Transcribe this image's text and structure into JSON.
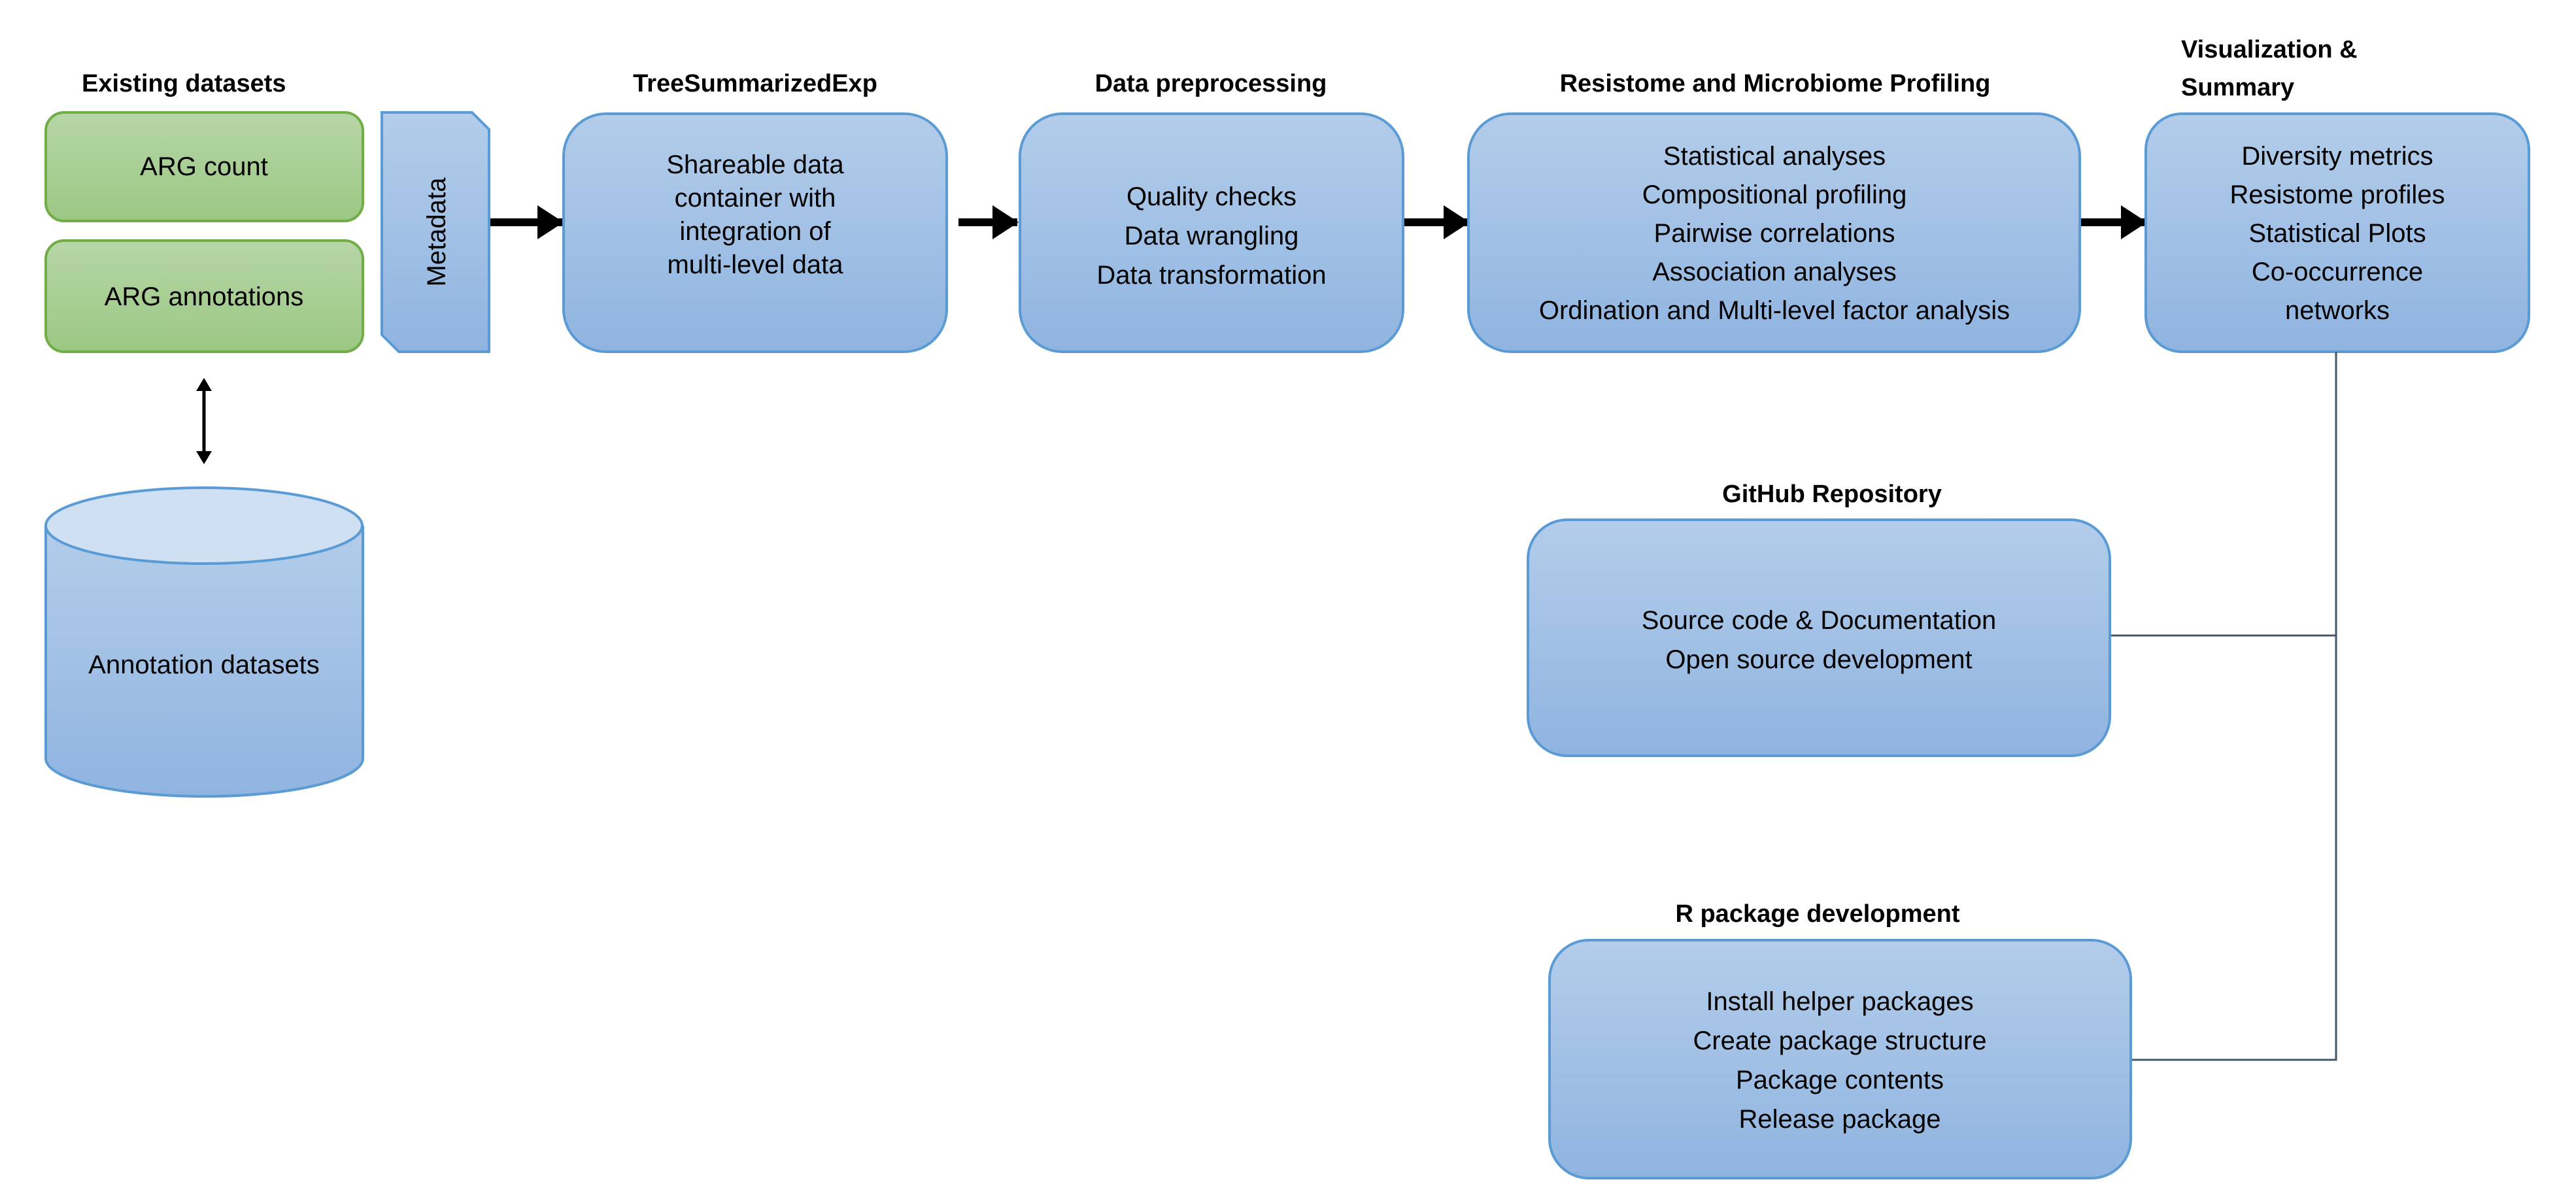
{
  "colors": {
    "box_fill_top": "#b3cdea",
    "box_fill_bottom": "#8fb4e0",
    "box_stroke": "#5b9bd5",
    "green_fill_top": "#b6d6a6",
    "green_fill_bottom": "#9bc783",
    "green_stroke": "#70ad47",
    "connector": "#44546a"
  },
  "existing": {
    "title": "Existing datasets",
    "arg_count": "ARG count",
    "arg_annotations": "ARG annotations"
  },
  "metadata": {
    "label": "Metadata"
  },
  "annotation_db": {
    "label": "Annotation datasets"
  },
  "tse": {
    "title": "TreeSummarizedExp",
    "lines": [
      "Shareable data",
      "container with",
      "integration of",
      "multi-level data"
    ]
  },
  "preprocessing": {
    "title": "Data preprocessing",
    "lines": [
      "Quality checks",
      "Data wrangling",
      "Data transformation"
    ]
  },
  "profiling": {
    "title": "Resistome and Microbiome Profiling",
    "lines": [
      "Statistical analyses",
      "Compositional profiling",
      "Pairwise correlations",
      "Association analyses",
      "Ordination and Multi-level factor analysis"
    ]
  },
  "visualization": {
    "title_lines": [
      "Visualization &",
      "Summary"
    ],
    "lines": [
      "Diversity metrics",
      "Resistome profiles",
      "Statistical Plots",
      "Co-occurrence",
      "networks"
    ]
  },
  "github": {
    "title": "GitHub Repository",
    "lines": [
      "Source code & Documentation",
      "Open source development"
    ]
  },
  "rpackage": {
    "title": "R package development",
    "lines": [
      "Install helper packages",
      "Create package structure",
      "Package contents",
      "Release package"
    ]
  }
}
